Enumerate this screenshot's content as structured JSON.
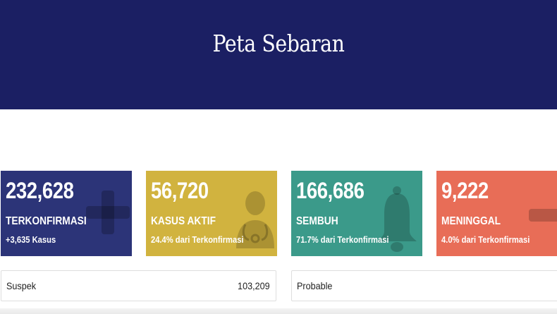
{
  "header": {
    "title": "Peta Sebaran",
    "background": "#1b1f63"
  },
  "cards": {
    "confirmed": {
      "number": "232,628",
      "label": "TERKONFIRMASI",
      "sub": "+3,635 Kasus",
      "color": "#2c3478",
      "icon": "plus-icon"
    },
    "active": {
      "number": "56,720",
      "label": "KASUS AKTIF",
      "sub": "24.4% dari Terkonfirmasi",
      "color": "#d1b33f",
      "icon": "doctor-icon"
    },
    "recovered": {
      "number": "166,686",
      "label": "SEMBUH",
      "sub": "71.7% dari Terkonfirmasi",
      "color": "#3b9a8a",
      "icon": "bell-icon"
    },
    "deaths": {
      "number": "9,222",
      "label": "MENINGGAL",
      "sub": "4.0% dari Terkonfirmasi",
      "color": "#e86d57",
      "icon": "minus-icon"
    }
  },
  "info": {
    "suspek": {
      "label": "Suspek",
      "value": "103,209"
    },
    "probable": {
      "label": "Probable",
      "value": ""
    }
  }
}
